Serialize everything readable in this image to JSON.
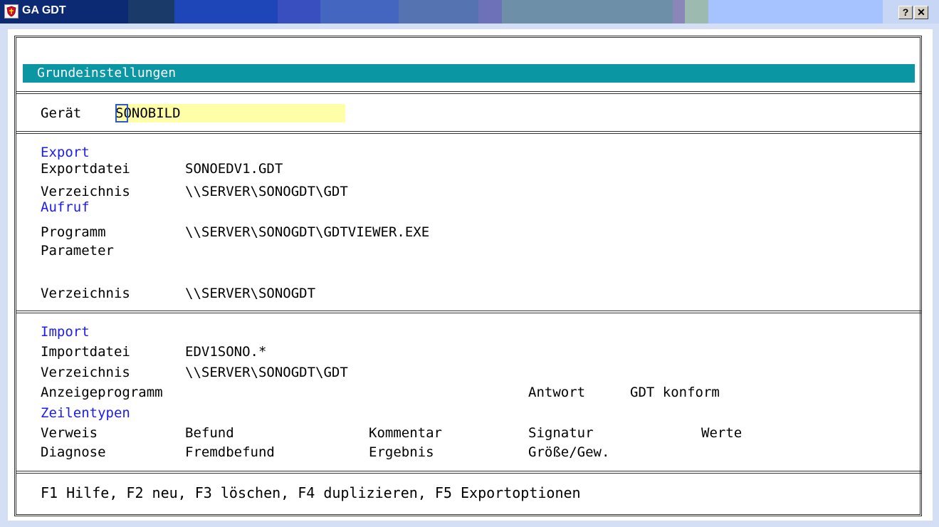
{
  "window": {
    "title": "GA GDT",
    "help_label": "?",
    "close_label": "✕",
    "icon": "app-shield-icon"
  },
  "header": {
    "title": "Grundeinstellungen"
  },
  "device": {
    "label": "Gerät",
    "value": "SONOBILD"
  },
  "export": {
    "heading": "Export",
    "file_label": "Exportdatei",
    "file_value": "SONOEDV1.GDT",
    "dir_label": "Verzeichnis",
    "dir_value": "\\\\SERVER\\SONOGDT\\GDT"
  },
  "call": {
    "heading": "Aufruf",
    "program_label": "Programm",
    "program_value": "\\\\SERVER\\SONOGDT\\GDTVIEWER.EXE",
    "param_label": "Parameter",
    "param_value": "",
    "dir_label": "Verzeichnis",
    "dir_value": "\\\\SERVER\\SONOGDT"
  },
  "import": {
    "heading": "Import",
    "file_label": "Importdatei",
    "file_value": "EDV1SONO.*",
    "dir_label": "Verzeichnis",
    "dir_value": "\\\\SERVER\\SONOGDT\\GDT",
    "viewer_label": "Anzeigeprogramm",
    "answer_label": "Antwort",
    "answer_value": "GDT konform"
  },
  "line_types": {
    "heading": "Zeilentypen",
    "row1": [
      "Verweis",
      "Befund",
      "Kommentar",
      "Signatur",
      "Werte"
    ],
    "row2": [
      "Diagnose",
      "Fremdbefund",
      "Ergebnis",
      "Größe/Gew."
    ]
  },
  "footer": {
    "hint": "F1 Hilfe, F2 neu, F3 löschen, F4 duplizieren, F5 Exportoptionen"
  },
  "colors": {
    "header_bg": "#0b96a4",
    "input_bg": "#ffffa8",
    "heading_text": "#1c1cf0"
  }
}
